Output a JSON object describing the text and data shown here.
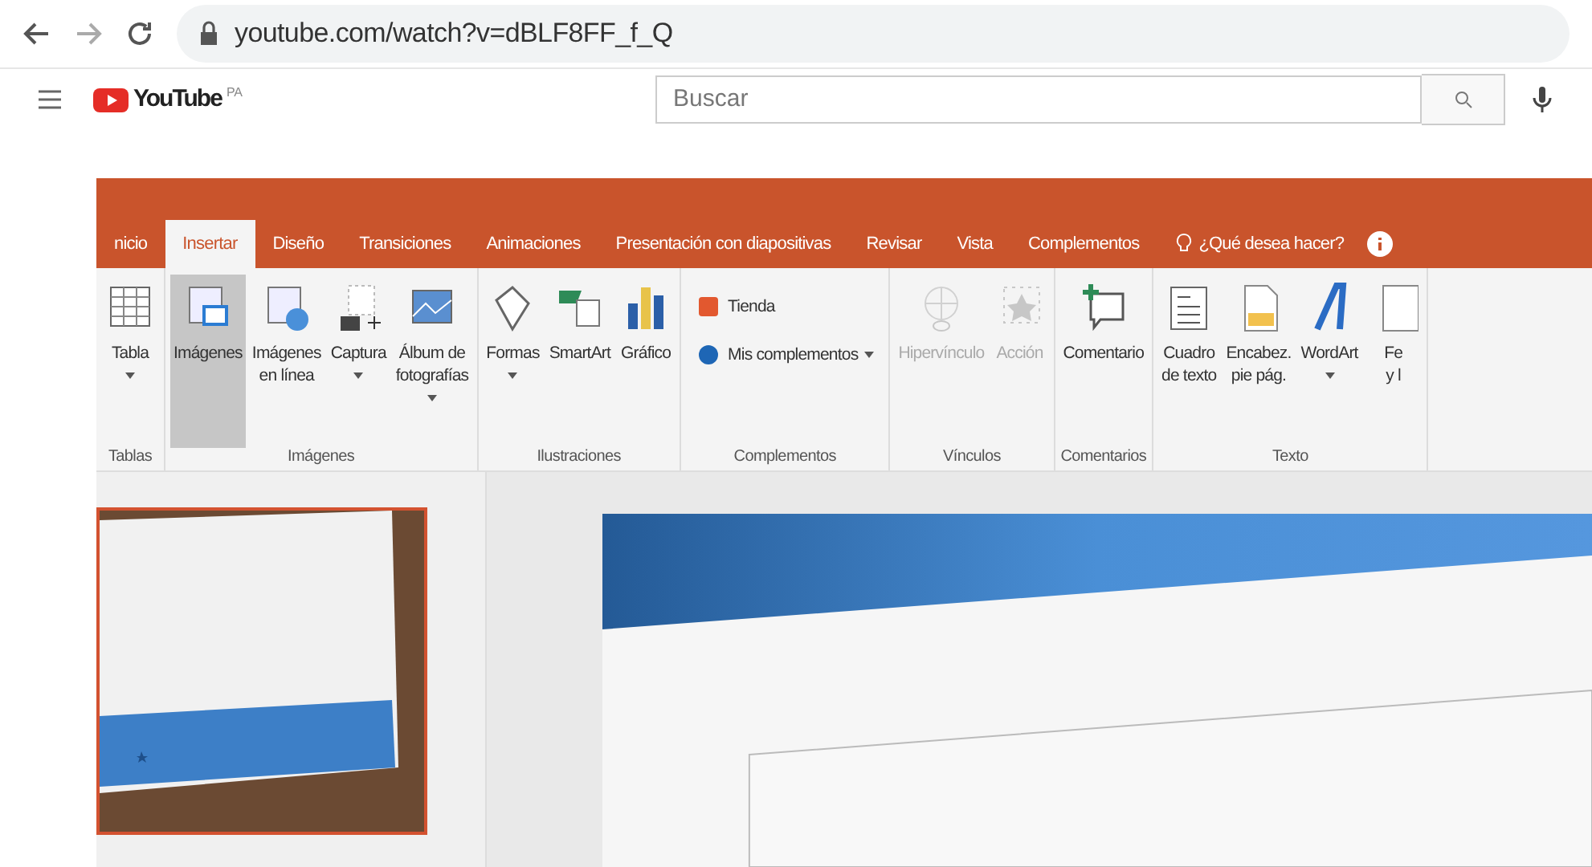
{
  "browser": {
    "url": "youtube.com/watch?v=dBLF8FF_f_Q"
  },
  "youtube": {
    "logo": "YouTube",
    "region": "PA",
    "search": {
      "placeholder": "Buscar"
    }
  },
  "video": {
    "ribbon": {
      "tabs": [
        {
          "label": "nicio",
          "selected": false
        },
        {
          "label": "Insertar",
          "selected": true
        },
        {
          "label": "Diseño",
          "selected": false
        },
        {
          "label": "Transiciones",
          "selected": false
        },
        {
          "label": "Animaciones",
          "selected": false
        },
        {
          "label": "Presentación con diapositivas",
          "selected": false
        },
        {
          "label": "Revisar",
          "selected": false
        },
        {
          "label": "Vista",
          "selected": false
        },
        {
          "label": "Complementos",
          "selected": false
        }
      ],
      "tell_me": "¿Qué desea hacer?",
      "groups": [
        {
          "label": "Tablas",
          "items": [
            {
              "kind": "large",
              "lines": [
                "Tabla"
              ],
              "dropdown": true,
              "disabled": false,
              "highlighted": false
            }
          ]
        },
        {
          "label": "Imágenes",
          "items": [
            {
              "kind": "large",
              "lines": [
                "Imágenes"
              ],
              "dropdown": false,
              "disabled": false,
              "highlighted": true
            },
            {
              "kind": "large",
              "lines": [
                "Imágenes",
                "en línea"
              ],
              "dropdown": false,
              "disabled": false,
              "highlighted": false
            },
            {
              "kind": "large",
              "lines": [
                "Captura"
              ],
              "dropdown": true,
              "disabled": false,
              "highlighted": false
            },
            {
              "kind": "large",
              "lines": [
                "Álbum de",
                "fotografías"
              ],
              "dropdown": true,
              "disabled": false,
              "highlighted": false
            }
          ]
        },
        {
          "label": "Ilustraciones",
          "items": [
            {
              "kind": "large",
              "lines": [
                "Formas"
              ],
              "dropdown": true,
              "disabled": false,
              "highlighted": false
            },
            {
              "kind": "large",
              "lines": [
                "SmartArt"
              ],
              "dropdown": false,
              "disabled": false,
              "highlighted": false
            },
            {
              "kind": "large",
              "lines": [
                "Gráfico"
              ],
              "dropdown": false,
              "disabled": false,
              "highlighted": false
            }
          ]
        },
        {
          "label": "Complementos",
          "items": [
            {
              "kind": "small",
              "lines": [
                "Tienda"
              ],
              "dropdown": false,
              "disabled": false,
              "highlighted": false
            },
            {
              "kind": "small",
              "lines": [
                "Mis complementos"
              ],
              "dropdown": true,
              "disabled": false,
              "highlighted": false
            }
          ]
        },
        {
          "label": "Vínculos",
          "items": [
            {
              "kind": "large",
              "lines": [
                "Hipervínculo"
              ],
              "dropdown": false,
              "disabled": true,
              "highlighted": false
            },
            {
              "kind": "large",
              "lines": [
                "Acción"
              ],
              "dropdown": false,
              "disabled": true,
              "highlighted": false
            }
          ]
        },
        {
          "label": "Comentarios",
          "items": [
            {
              "kind": "large",
              "lines": [
                "Comentario"
              ],
              "dropdown": false,
              "disabled": false,
              "highlighted": false
            }
          ]
        },
        {
          "label": "Texto",
          "items": [
            {
              "kind": "large",
              "lines": [
                "Cuadro",
                "de texto"
              ],
              "dropdown": false,
              "disabled": false,
              "highlighted": false
            },
            {
              "kind": "large",
              "lines": [
                "Encabez.",
                "pie pág."
              ],
              "dropdown": false,
              "disabled": false,
              "highlighted": false
            },
            {
              "kind": "large",
              "lines": [
                "WordArt"
              ],
              "dropdown": true,
              "disabled": false,
              "highlighted": false
            },
            {
              "kind": "large",
              "lines": [
                "Fe",
                "y l"
              ],
              "dropdown": false,
              "disabled": false,
              "highlighted": false
            }
          ]
        }
      ]
    }
  }
}
